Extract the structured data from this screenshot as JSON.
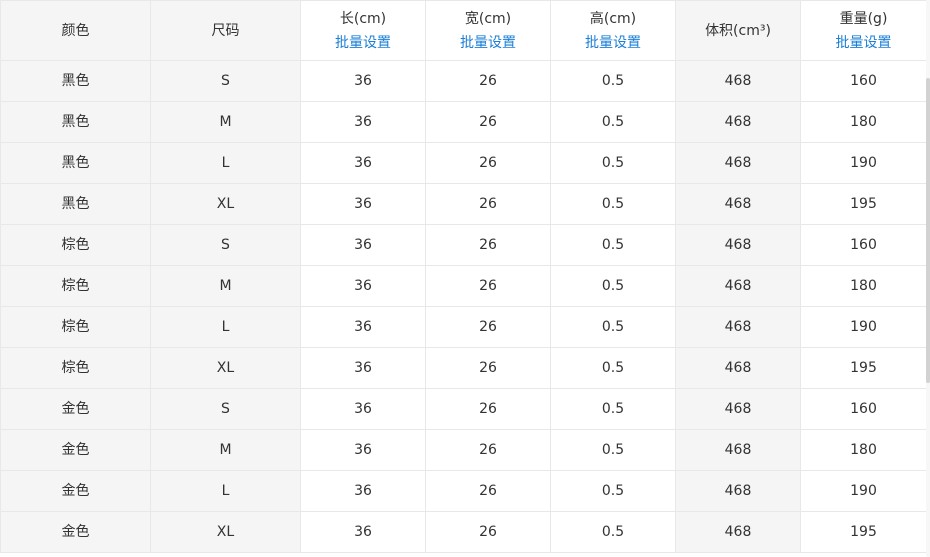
{
  "headers": [
    {
      "key": "color",
      "label": "颜色",
      "batch": ""
    },
    {
      "key": "size",
      "label": "尺码",
      "batch": ""
    },
    {
      "key": "length",
      "label": "长(cm)",
      "batch": "批量设置"
    },
    {
      "key": "width",
      "label": "宽(cm)",
      "batch": "批量设置"
    },
    {
      "key": "height",
      "label": "高(cm)",
      "batch": "批量设置"
    },
    {
      "key": "volume",
      "label": "体积(cm³)",
      "batch": ""
    },
    {
      "key": "weight",
      "label": "重量(g)",
      "batch": "批量设置"
    }
  ],
  "rows": [
    {
      "color": "黑色",
      "size": "S",
      "length": "36",
      "width": "26",
      "height": "0.5",
      "volume": "468",
      "weight": "160"
    },
    {
      "color": "黑色",
      "size": "M",
      "length": "36",
      "width": "26",
      "height": "0.5",
      "volume": "468",
      "weight": "180"
    },
    {
      "color": "黑色",
      "size": "L",
      "length": "36",
      "width": "26",
      "height": "0.5",
      "volume": "468",
      "weight": "190"
    },
    {
      "color": "黑色",
      "size": "XL",
      "length": "36",
      "width": "26",
      "height": "0.5",
      "volume": "468",
      "weight": "195"
    },
    {
      "color": "棕色",
      "size": "S",
      "length": "36",
      "width": "26",
      "height": "0.5",
      "volume": "468",
      "weight": "160"
    },
    {
      "color": "棕色",
      "size": "M",
      "length": "36",
      "width": "26",
      "height": "0.5",
      "volume": "468",
      "weight": "180"
    },
    {
      "color": "棕色",
      "size": "L",
      "length": "36",
      "width": "26",
      "height": "0.5",
      "volume": "468",
      "weight": "190"
    },
    {
      "color": "棕色",
      "size": "XL",
      "length": "36",
      "width": "26",
      "height": "0.5",
      "volume": "468",
      "weight": "195"
    },
    {
      "color": "金色",
      "size": "S",
      "length": "36",
      "width": "26",
      "height": "0.5",
      "volume": "468",
      "weight": "160"
    },
    {
      "color": "金色",
      "size": "M",
      "length": "36",
      "width": "26",
      "height": "0.5",
      "volume": "468",
      "weight": "180"
    },
    {
      "color": "金色",
      "size": "L",
      "length": "36",
      "width": "26",
      "height": "0.5",
      "volume": "468",
      "weight": "190"
    },
    {
      "color": "金色",
      "size": "XL",
      "length": "36",
      "width": "26",
      "height": "0.5",
      "volume": "468",
      "weight": "195"
    }
  ],
  "colors": {
    "link": "#1a7ed6",
    "readonly_bg": "#f5f5f5",
    "border": "#e8e8e8",
    "text": "#333333"
  }
}
